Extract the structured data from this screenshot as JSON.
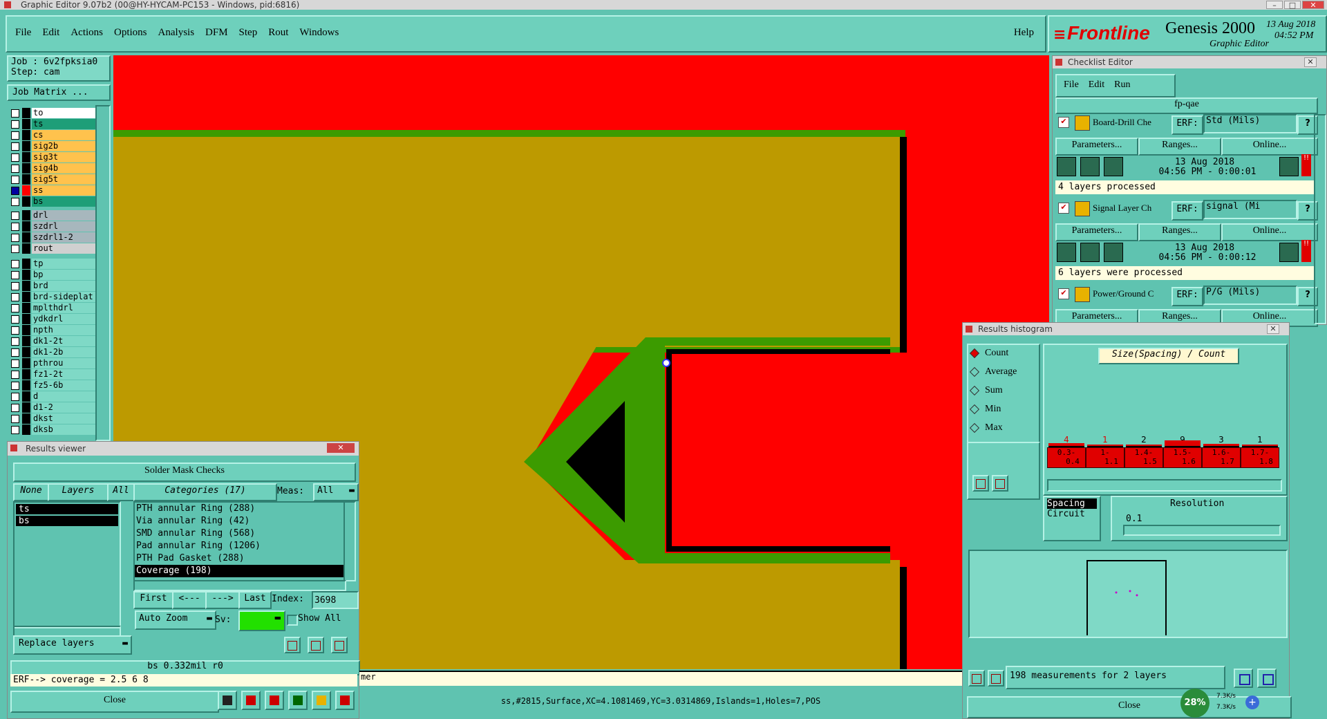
{
  "window_title": "Graphic Editor 9.07b2 (00@HY-HYCAM-PC153 - Windows, pid:6816)",
  "menu": [
    "File",
    "Edit",
    "Actions",
    "Options",
    "Analysis",
    "DFM",
    "Step",
    "Rout",
    "Windows"
  ],
  "help_label": "Help",
  "brand": {
    "name": "Frontline",
    "product": "Genesis 2000",
    "subtitle": "Graphic Editor",
    "date": "13 Aug 2018",
    "time": "04:52 PM"
  },
  "job": {
    "job_label": "Job : 6v2fpksia0",
    "step_label": "Step: cam",
    "matrix_button": "Job Matrix ..."
  },
  "layers_group1": [
    {
      "name": "to",
      "color": "#ffffff"
    },
    {
      "name": "ts",
      "color": "#1e9e78"
    },
    {
      "name": "cs",
      "color": "#ffc24d"
    },
    {
      "name": "sig2b",
      "color": "#ffc24d"
    },
    {
      "name": "sig3t",
      "color": "#ffc24d"
    },
    {
      "name": "sig4b",
      "color": "#ffc24d"
    },
    {
      "name": "sig5t",
      "color": "#ffc24d"
    },
    {
      "name": "ss",
      "color": "#ffc24d"
    },
    {
      "name": "bs",
      "color": "#1e9e78"
    }
  ],
  "layers_group2": [
    {
      "name": "drl",
      "color": "#a7b7bd"
    },
    {
      "name": "szdrl",
      "color": "#a7b7bd"
    },
    {
      "name": "szdrl1-2",
      "color": "#a7b7bd"
    },
    {
      "name": "rout",
      "color": "#d0d0d0"
    }
  ],
  "layers_group3": [
    "tp",
    "bp",
    "brd",
    "brd-sideplat",
    "mplthdrl",
    "ydkdrl",
    "npth",
    "dk1-2t",
    "dk1-2b",
    "pthrou",
    "fz1-2t",
    "fz5-6b",
    "d",
    "d1-2",
    "dkst",
    "dksb"
  ],
  "checklist": {
    "title": "Checklist Editor",
    "menu": [
      "File",
      "Edit",
      "Run"
    ],
    "name": "fp-qae",
    "erf_label": "ERF:",
    "param_label": "Parameters...",
    "ranges_label": "Ranges...",
    "online_label": "Online...",
    "items": [
      {
        "name": "Board-Drill Che",
        "erf": "Std (Mils)",
        "date": "13 Aug 2018",
        "time": "04:56 PM - 0:00:01",
        "status": "4 layers processed"
      },
      {
        "name": "Signal Layer Ch",
        "erf": "signal (Mi",
        "date": "13 Aug 2018",
        "time": "04:56 PM - 0:00:12",
        "status": "6 layers were processed"
      },
      {
        "name": "Power/Ground C",
        "erf": "P/G (Mils)"
      }
    ]
  },
  "results_viewer": {
    "title": "Results viewer",
    "heading": "Solder Mask Checks",
    "none_label": "None",
    "layers_label": "Layers",
    "all_label": "All",
    "categories_label": "Categories (17)",
    "meas_label": "Meas:",
    "meas_value": "All",
    "layers": [
      "ts",
      "bs"
    ],
    "categories": [
      "PTH annular Ring (288)",
      "Via annular Ring (42)",
      "SMD annular Ring (568)",
      "Pad annular Ring (1206)",
      "PTH Pad Gasket (288)",
      "Coverage (198)"
    ],
    "first_label": "First",
    "prev_label": "<---",
    "next_label": "--->",
    "last_label": "Last",
    "index_label": "Index:",
    "index_value": "3698",
    "autozoom_label": "Auto Zoom",
    "sv_label": "Sv:",
    "showall_label": "Show All",
    "replace_label": "Replace layers",
    "info": "bs 0.332mil  r0",
    "erf_line": "ERF--> coverage = 2.5 6 8",
    "close_label": "Close"
  },
  "histogram": {
    "title": "Results histogram",
    "options": [
      "Count",
      "Average",
      "Sum",
      "Min",
      "Max"
    ],
    "selected": "Count",
    "chart_title": "Size(Spacing) / Count",
    "counts": [
      "4",
      "1",
      "2",
      "9",
      "3",
      "1"
    ],
    "count_colors": [
      "#e00000",
      "#e00000",
      "#000000",
      "#000000",
      "#000000",
      "#000000"
    ],
    "ranges": [
      [
        "0.3-",
        "0.4"
      ],
      [
        "1-",
        "1.1"
      ],
      [
        "1.4-",
        "1.5"
      ],
      [
        "1.5-",
        "1.6"
      ],
      [
        "1.6-",
        "1.7"
      ],
      [
        "1.7-",
        "1.8"
      ]
    ],
    "type_items": [
      "Spacing",
      "Circuit"
    ],
    "resolution_label": "Resolution",
    "resolution_value": "0.1",
    "measurements": "198 measurements for 2 layers",
    "close_label": "Close"
  },
  "status_bar": "ss,#2815,Surface,XC=4.1081469,YC=3.0314869,Islands=1,Holes=7,POS",
  "partial_text": "mer",
  "net": {
    "percent": "28%",
    "up": "7.3K/s",
    "down": "7.3K/s"
  },
  "colors": {
    "background": "#5fc3b0",
    "canvas_red": "#ff0000",
    "copper": "#bd9a00",
    "mask_green": "#3c9b00",
    "accent_red": "#e00000"
  }
}
